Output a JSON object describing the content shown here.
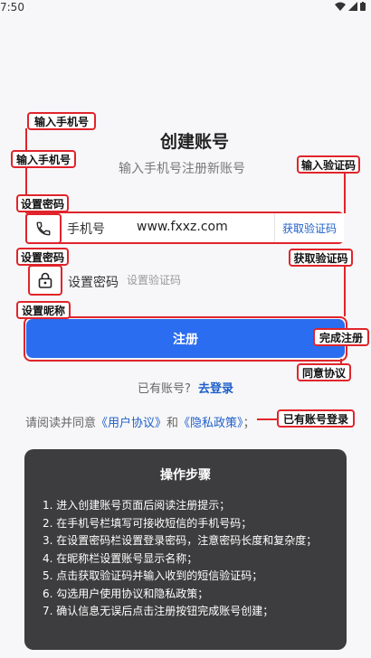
{
  "status_bar": {
    "time": "7:50"
  },
  "header": {
    "title": "创建账号",
    "subtitle": "输入手机号注册新账号"
  },
  "phone": {
    "label": "手机号",
    "value": "www.fxxz.com",
    "get_code_label": "获取验证码"
  },
  "password": {
    "label": "设置密码",
    "placeholder": "设置验证码"
  },
  "register_button": "注册",
  "login": {
    "prompt": "已有账号?",
    "link": "去登录"
  },
  "agreement": {
    "prefix": "请阅读并同意",
    "user_agreement": "《用户协议》",
    "conjunction": "和",
    "privacy_policy": "《隐私政策》",
    "suffix": "；"
  },
  "callouts": {
    "enter_phone_1": "输入手机号",
    "enter_phone_2": "输入手机号",
    "enter_code": "输入验证码",
    "set_password_1": "设置密码",
    "set_password_2": "设置密码",
    "get_code": "获取验证码",
    "set_nickname": "设置昵称",
    "complete_register": "完成注册",
    "agree_terms": "同意协议",
    "have_account_login": "已有账号登录"
  },
  "steps": {
    "title": "操作步骤",
    "items": [
      "1. 进入创建账号页面后阅读注册提示；",
      "2. 在手机号栏填写可接收短信的手机号码；",
      "3. 在设置密码栏设置登录密码，注意密码长度和复杂度；",
      "4. 在昵称栏设置账号显示名称；",
      "5. 点击获取验证码并输入收到的短信验证码；",
      "6. 勾选用户使用协议和隐私政策；",
      "7. 确认信息无误后点击注册按钮完成账号创建；"
    ]
  },
  "colors": {
    "accent": "#2a6df0",
    "link": "#1f5fc9",
    "annotation": "#e0242b",
    "card": "#3d3d3f"
  }
}
